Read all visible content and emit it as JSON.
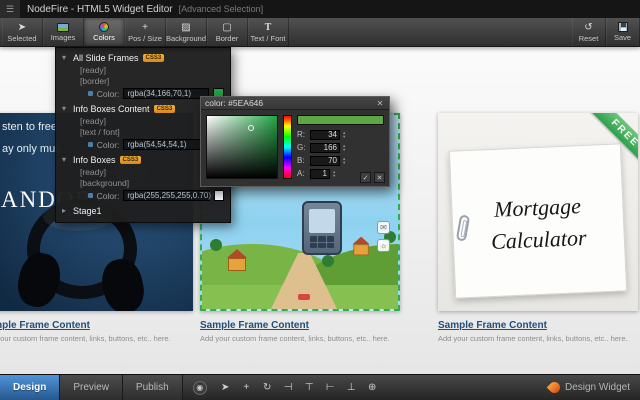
{
  "titlebar": {
    "title": "NodeFire - HTML5 Widget Editor",
    "badge": "[Advanced Selection]"
  },
  "toolbar": {
    "buttons": [
      {
        "label": "Selected"
      },
      {
        "label": "Images"
      },
      {
        "label": "Colors"
      },
      {
        "label": "Pos / Size"
      },
      {
        "label": "Background"
      },
      {
        "label": "Border"
      },
      {
        "label": "Text / Font"
      }
    ],
    "reset_label": "Reset",
    "save_label": "Save"
  },
  "panel": {
    "sections": [
      {
        "name": "All Slide Frames",
        "badge": "CSS3",
        "item1": "[ready]",
        "item2": "[border]",
        "color_label": "Color:",
        "color_value": "rgba(34,166,70,1)",
        "swatch": "#22A646"
      },
      {
        "name": "Info Boxes Content",
        "badge": "CSS3",
        "item1": "[ready]",
        "item2": "[text / font]",
        "color_label": "Color:",
        "color_value": "rgba(54,54,54,1)",
        "swatch": "#363636"
      },
      {
        "name": "Info Boxes",
        "badge": "CSS3",
        "item1": "[ready]",
        "item2": "[background]",
        "color_label": "Color:",
        "color_value": "rgba(255,255,255,0.70)",
        "swatch": "#FFFFFF"
      },
      {
        "name": "Stage1"
      }
    ]
  },
  "picker": {
    "title": "color: #5EA646",
    "swatch_color": "#5EA646",
    "fields": [
      {
        "label": "R:",
        "value": "34"
      },
      {
        "label": "G:",
        "value": "166"
      },
      {
        "label": "B:",
        "value": "70"
      },
      {
        "label": "A:",
        "value": "1"
      }
    ]
  },
  "slides": {
    "pandora": {
      "line1": "sten to free",
      "line2": "ay only mus",
      "brand": "ANDOR"
    },
    "mortgage": {
      "line1": "Mortgage",
      "line2": "Calculator",
      "ribbon": "FREE"
    }
  },
  "frames": [
    {
      "title": "Sample Frame Content",
      "desc": "Add your custom frame content, links, buttons, etc.. here."
    },
    {
      "title": "Sample Frame Content",
      "desc": "Add your custom frame content, links, buttons, etc.. here."
    },
    {
      "title": "Sample Frame Content",
      "desc": "Add your custom frame content, links, buttons, etc.. here."
    }
  ],
  "bottombar": {
    "tabs": [
      {
        "label": "Design"
      },
      {
        "label": "Preview"
      },
      {
        "label": "Publish"
      }
    ],
    "brand": "Design Widget"
  },
  "icons": {
    "menu": "☰",
    "selected": "➤",
    "pos_size": "+",
    "background": "▨",
    "border": "▢",
    "text_font": "T",
    "reset": "↺",
    "close": "✕",
    "ok": "✓",
    "cancel": "✕",
    "caret_open": "▾",
    "caret_closed": "▸",
    "step_up": "▴",
    "step_down": "▾",
    "pointer": "➤",
    "move": "+",
    "rotate": "↻",
    "align_left": "⊣",
    "align_top": "⊤",
    "align_right": "⊢",
    "align_bottom": "⊥",
    "zoom": "⊕",
    "target": "◉",
    "mail": "✉",
    "sun": "☼"
  },
  "colors": {
    "selection_green": "#2fae4f",
    "picker_hex": "#5EA646",
    "border_swatch_green": "#22A646",
    "tab_active_blue": "#26578f"
  }
}
